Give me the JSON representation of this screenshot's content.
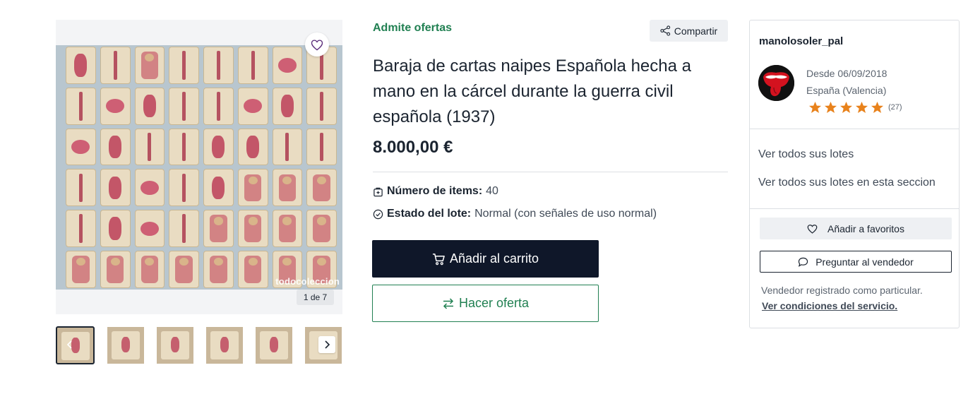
{
  "gallery": {
    "watermark": "todocoleccion",
    "counter": "1 de 7",
    "favorite_icon": "heart-icon",
    "prev_icon": "chevron-left-icon",
    "next_icon": "chevron-right-icon",
    "thumbnail_count": 6
  },
  "listing": {
    "offers_tag": "Admite ofertas",
    "share_label": "Compartir",
    "title": "Baraja de cartas naipes Española hecha a mano en la cárcel durante la guerra civil española (1937)",
    "price": "8.000,00 €",
    "attributes": [
      {
        "icon": "package-icon",
        "label": "Número de items:",
        "value": "40"
      },
      {
        "icon": "check-circle-icon",
        "label": "Estado del lote:",
        "value": "Normal (con señales de uso normal)"
      }
    ],
    "cart_button": "Añadir al carrito",
    "offer_button": "Hacer oferta"
  },
  "seller": {
    "name": "manolosoler_pal",
    "since": "Desde 06/09/2018",
    "location": "España (Valencia)",
    "rating_stars": 5,
    "rating_count": "(27)",
    "link_all_lots": "Ver todos sus lotes",
    "link_section_lots": "Ver todos sus lotes en esta seccion",
    "favorites_button": "Añadir a favoritos",
    "ask_button": "Preguntar al vendedor",
    "note": "Vendedor registrado como particular.",
    "terms_link": "Ver condiciones del servicio."
  },
  "colors": {
    "accent_green": "#218052",
    "dark_button": "#0f1729",
    "star": "#e8821c",
    "heart": "#5a2c7a"
  }
}
